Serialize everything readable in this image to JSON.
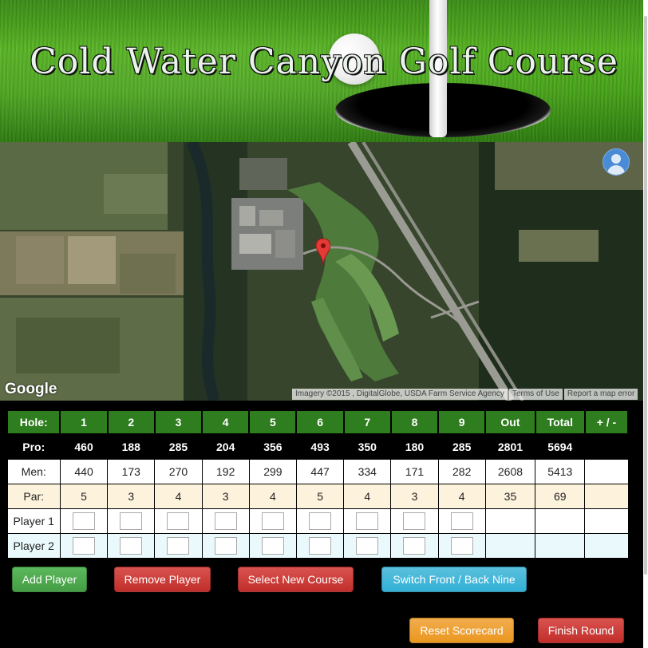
{
  "header": {
    "title": "Cold Water Canyon Golf Course"
  },
  "map": {
    "provider_logo": "Google",
    "attribution": [
      "Imagery ©2015 , DigitalGlobe, USDA Farm Service Agency",
      "Terms of Use",
      "Report a map error"
    ],
    "avatar_icon": "person-icon",
    "marker_icon": "map-pin-icon"
  },
  "scorecard": {
    "header": [
      "Hole:",
      "1",
      "2",
      "3",
      "4",
      "5",
      "6",
      "7",
      "8",
      "9",
      "Out",
      "Total",
      "+ / -"
    ],
    "pro": [
      "Pro:",
      "460",
      "188",
      "285",
      "204",
      "356",
      "493",
      "350",
      "180",
      "285",
      "2801",
      "5694",
      ""
    ],
    "men": [
      "Men:",
      "440",
      "173",
      "270",
      "192",
      "299",
      "447",
      "334",
      "171",
      "282",
      "2608",
      "5413",
      ""
    ],
    "par": [
      "Par:",
      "5",
      "3",
      "4",
      "3",
      "4",
      "5",
      "4",
      "3",
      "4",
      "35",
      "69",
      ""
    ],
    "players": [
      "Player 1",
      "Player 2"
    ]
  },
  "buttons": {
    "add_player": "Add Player",
    "remove_player": "Remove Player",
    "select_course": "Select New Course",
    "switch_nine": "Switch Front / Back Nine",
    "reset": "Reset Scorecard",
    "finish": "Finish Round"
  },
  "colors": {
    "header_row": "#2e7d1e",
    "par_row": "#fdf3dc",
    "player2_row": "#eaf9fb"
  }
}
